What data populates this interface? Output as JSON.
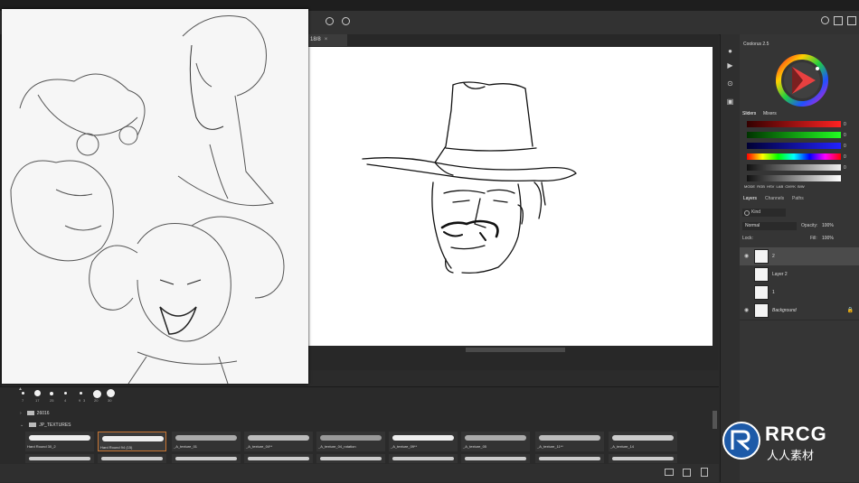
{
  "app": {
    "doc_tab_label": "18/8",
    "doc_tab_close": "×"
  },
  "brushes": {
    "sizes": [
      "?",
      "?",
      "?",
      "?",
      "?",
      "?",
      "?",
      "?"
    ],
    "size_numbers": [
      "7",
      "17",
      "25",
      "4",
      "9",
      "3",
      "20",
      "30"
    ],
    "groups": [
      {
        "label": "26016"
      },
      {
        "label": "JP_TEXTURES"
      }
    ],
    "presets": [
      {
        "label": "Hard Round 30_2"
      },
      {
        "label": "Hard Round 94 (15)"
      },
      {
        "label": "_A_texture_01"
      },
      {
        "label": "_A_texture_04**"
      },
      {
        "label": "_A_texture_04_rotation"
      },
      {
        "label": "_A_texture_09**"
      },
      {
        "label": "_A_texture_05"
      },
      {
        "label": "_A_texture_11**"
      },
      {
        "label": "_A_texture_14"
      }
    ]
  },
  "right_panel": {
    "color_title": "Coolorus 2.5",
    "slider_tabs": [
      "Sliders",
      "Mixers"
    ],
    "slider_values": [
      "0",
      "0",
      "0",
      "0",
      "0"
    ],
    "color_modes": "MODE  RGB  HSV  LAB  CMYK  B/W",
    "layer_tabs": [
      "Layers",
      "Channels",
      "Paths"
    ],
    "kind_label": "Kind",
    "blend_mode": "Normal",
    "opacity_label": "Opacity:",
    "opacity_value": "100%",
    "lock_label": "Lock:",
    "fill_label": "Fill:",
    "fill_value": "100%",
    "layers": [
      {
        "name": "2",
        "selected": true
      },
      {
        "name": "Layer 2",
        "selected": false
      },
      {
        "name": "1",
        "selected": false
      },
      {
        "name": "Background",
        "selected": false
      }
    ]
  },
  "watermark": {
    "brand": "RRCG",
    "sub": "人人素材"
  },
  "colors": {
    "accent": "#c87532",
    "panel": "#353535",
    "workspace": "#282828"
  }
}
